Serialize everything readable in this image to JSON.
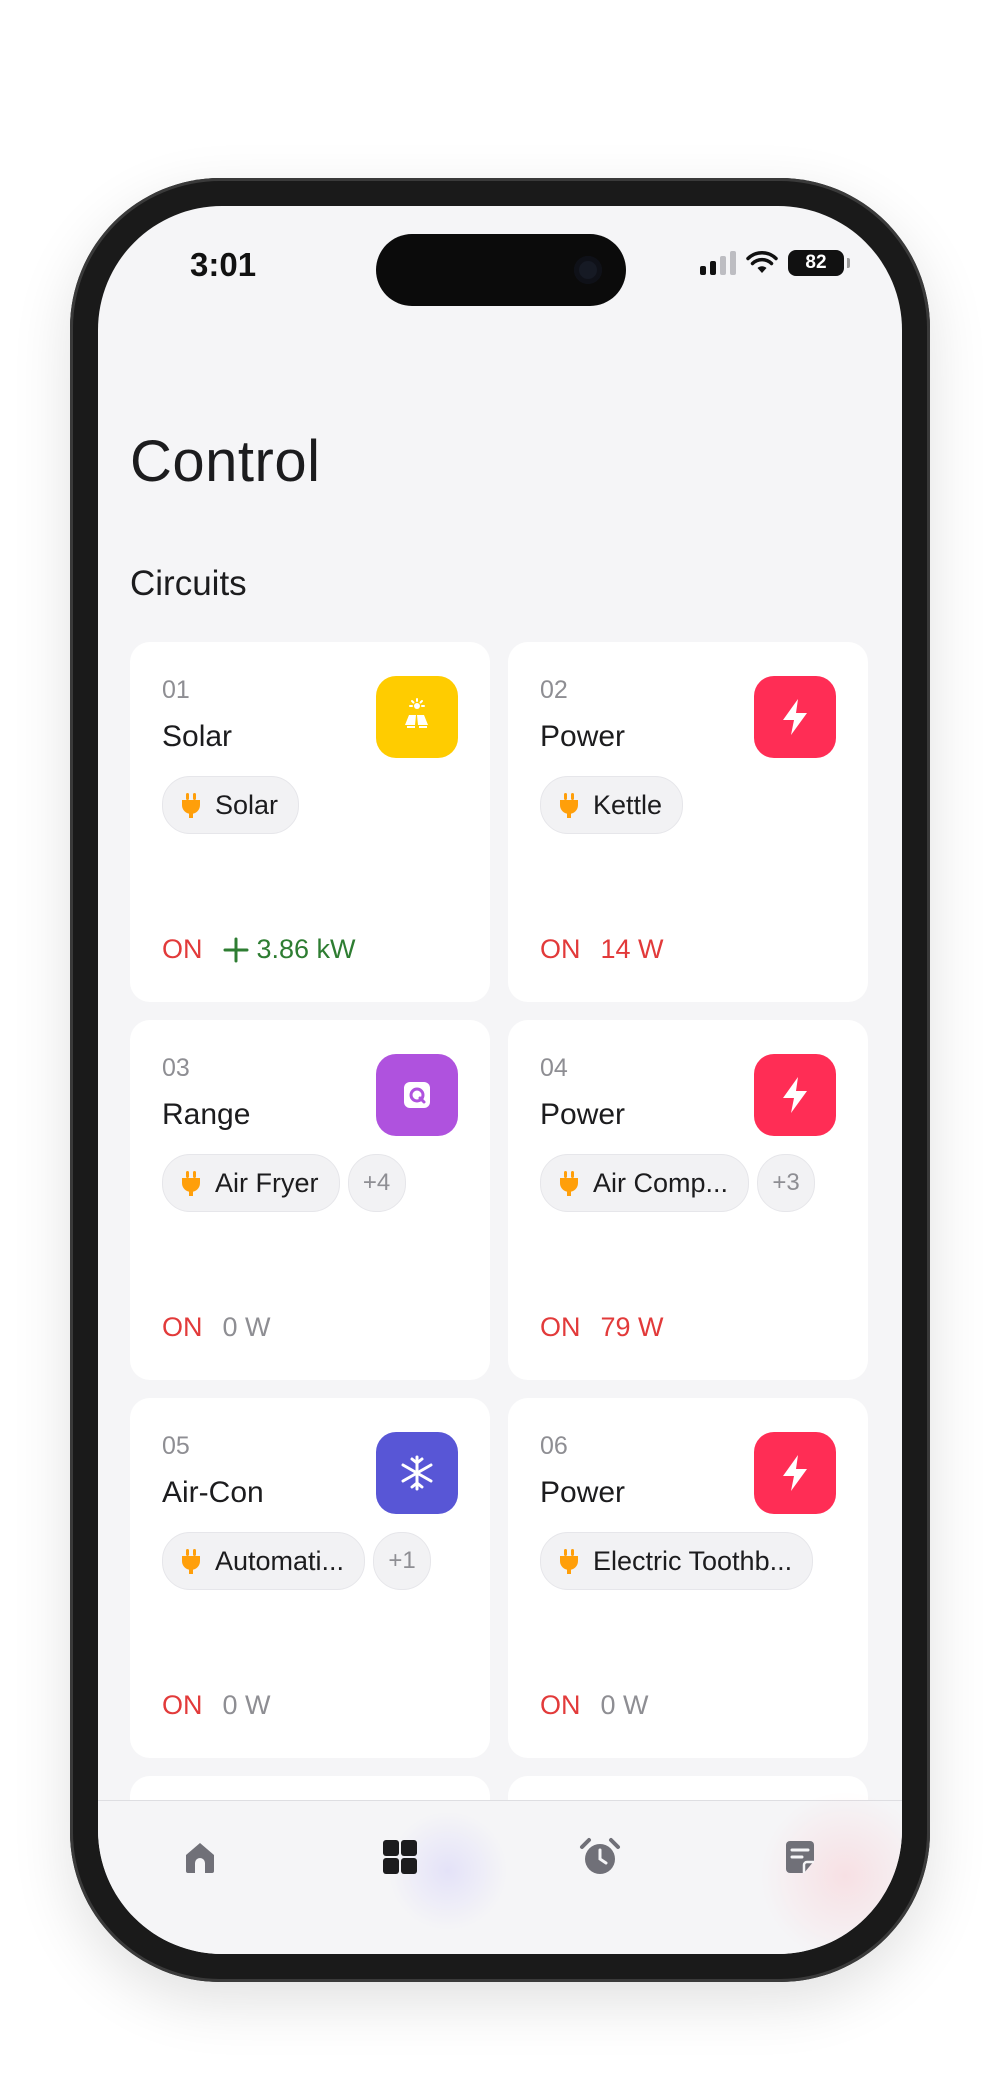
{
  "status_bar": {
    "time": "3:01",
    "battery": "82"
  },
  "page": {
    "title": "Control",
    "section": "Circuits"
  },
  "colors": {
    "solar": "#ffcc00",
    "power": "#ff2d55",
    "range": "#af52de",
    "aircon": "#5856d6",
    "on_red": "#e23a3a",
    "gain_green": "#2e7d32",
    "plug_orange": "#ff9f0a"
  },
  "circuits": [
    {
      "number": "01",
      "name": "Solar",
      "icon": "solar-panel-icon",
      "chip": "Solar",
      "more": "",
      "state": "ON",
      "power": "3.86 kW"
    },
    {
      "number": "02",
      "name": "Power",
      "icon": "lightning-bolt-icon",
      "chip": "Kettle",
      "more": "",
      "state": "ON",
      "power": "14 W"
    },
    {
      "number": "03",
      "name": "Range",
      "icon": "oven-icon",
      "chip": "Air Fryer",
      "more": "+4",
      "state": "ON",
      "power": "0 W"
    },
    {
      "number": "04",
      "name": "Power",
      "icon": "lightning-bolt-icon",
      "chip": "Air Comp...",
      "more": "+3",
      "state": "ON",
      "power": "79 W"
    },
    {
      "number": "05",
      "name": "Air-Con",
      "icon": "snowflake-icon",
      "chip": "Automati...",
      "more": "+1",
      "state": "ON",
      "power": "0 W"
    },
    {
      "number": "06",
      "name": "Power",
      "icon": "lightning-bolt-icon",
      "chip": "Electric Toothb...",
      "more": "",
      "state": "ON",
      "power": "0 W"
    }
  ],
  "tabs": [
    {
      "icon": "home-icon",
      "selected": false
    },
    {
      "icon": "grid-icon",
      "selected": true
    },
    {
      "icon": "alarm-clock-icon",
      "selected": false
    },
    {
      "icon": "notes-icon",
      "selected": false
    }
  ]
}
